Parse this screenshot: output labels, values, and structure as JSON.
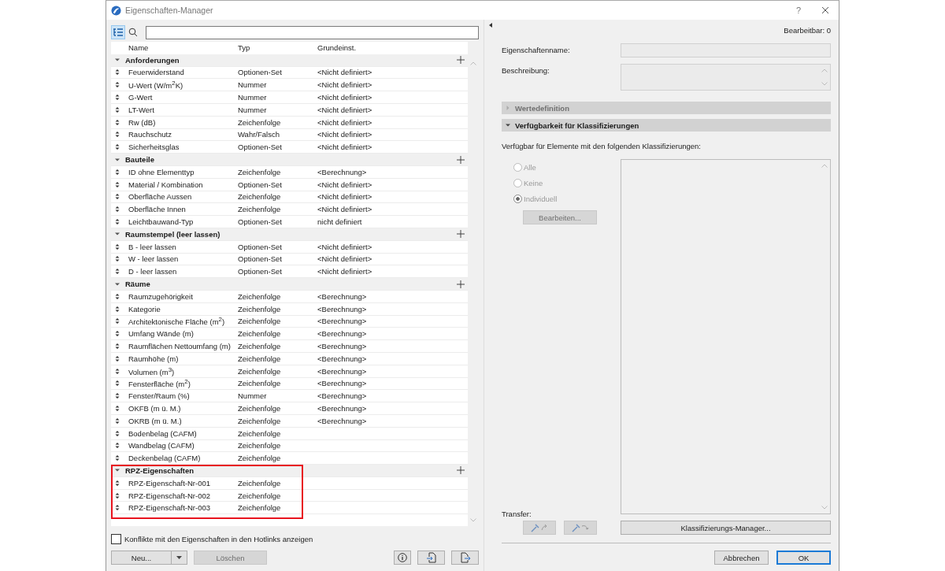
{
  "window": {
    "title": "Eigenschaften-Manager",
    "help": "?"
  },
  "toolbar": {
    "list_view_on": true
  },
  "table": {
    "columns": [
      "Name",
      "Typ",
      "Grundeinst."
    ],
    "groups": [
      {
        "name": "Anforderungen",
        "expanded": true,
        "highlighted": false,
        "items": [
          {
            "name": "Feuerwiderstand",
            "type": "Optionen-Set",
            "default": "<Nicht definiert>"
          },
          {
            "name": "U-Wert (W/m$^{2}$K)",
            "type": "Nummer",
            "default": "<Nicht definiert>"
          },
          {
            "name": "G-Wert",
            "type": "Nummer",
            "default": "<Nicht definiert>"
          },
          {
            "name": "LT-Wert",
            "type": "Nummer",
            "default": "<Nicht definiert>"
          },
          {
            "name": "Rw (dB)",
            "type": "Zeichenfolge",
            "default": "<Nicht definiert>"
          },
          {
            "name": "Rauchschutz",
            "type": "Wahr/Falsch",
            "default": "<Nicht definiert>"
          },
          {
            "name": "Sicherheitsglas",
            "type": "Optionen-Set",
            "default": "<Nicht definiert>"
          }
        ]
      },
      {
        "name": "Bauteile",
        "expanded": true,
        "highlighted": false,
        "items": [
          {
            "name": "ID ohne Elementtyp",
            "type": "Zeichenfolge",
            "default": "<Berechnung>"
          },
          {
            "name": "Material / Kombination",
            "type": "Optionen-Set",
            "default": "<Nicht definiert>"
          },
          {
            "name": "Oberfläche Aussen",
            "type": "Zeichenfolge",
            "default": "<Nicht definiert>"
          },
          {
            "name": "Oberfläche Innen",
            "type": "Zeichenfolge",
            "default": "<Nicht definiert>"
          },
          {
            "name": "Leichtbauwand-Typ",
            "type": "Optionen-Set",
            "default": "nicht definiert"
          }
        ]
      },
      {
        "name": "Raumstempel (leer lassen)",
        "expanded": true,
        "highlighted": false,
        "items": [
          {
            "name": "B - leer lassen",
            "type": "Optionen-Set",
            "default": "<Nicht definiert>"
          },
          {
            "name": "W - leer lassen",
            "type": "Optionen-Set",
            "default": "<Nicht definiert>"
          },
          {
            "name": "D - leer lassen",
            "type": "Optionen-Set",
            "default": "<Nicht definiert>"
          }
        ]
      },
      {
        "name": "Räume",
        "expanded": true,
        "highlighted": false,
        "items": [
          {
            "name": "Raumzugehörigkeit",
            "type": "Zeichenfolge",
            "default": "<Berechnung>"
          },
          {
            "name": "Kategorie",
            "type": "Zeichenfolge",
            "default": "<Berechnung>"
          },
          {
            "name": "Architektonische Fläche (m$^{2}$)",
            "type": "Zeichenfolge",
            "default": "<Berechnung>"
          },
          {
            "name": "Umfang Wände (m)",
            "type": "Zeichenfolge",
            "default": "<Berechnung>"
          },
          {
            "name": "Raumflächen Nettoumfang (m)",
            "type": "Zeichenfolge",
            "default": "<Berechnung>"
          },
          {
            "name": "Raumhöhe (m)",
            "type": "Zeichenfolge",
            "default": "<Berechnung>"
          },
          {
            "name": "Volumen (m$^{3}$)",
            "type": "Zeichenfolge",
            "default": "<Berechnung>"
          },
          {
            "name": "Fensterfläche (m$^{2}$)",
            "type": "Zeichenfolge",
            "default": "<Berechnung>"
          },
          {
            "name": "Fenster/Raum (%)",
            "type": "Nummer",
            "default": "<Berechnung>"
          },
          {
            "name": "OKFB (m ü. M.)",
            "type": "Zeichenfolge",
            "default": "<Berechnung>"
          },
          {
            "name": "OKRB (m ü. M.)",
            "type": "Zeichenfolge",
            "default": "<Berechnung>"
          },
          {
            "name": "Bodenbelag (CAFM)",
            "type": "Zeichenfolge"
          },
          {
            "name": "Wandbelag (CAFM)",
            "type": "Zeichenfolge"
          },
          {
            "name": "Deckenbelag (CAFM)",
            "type": "Zeichenfolge"
          }
        ]
      },
      {
        "name": "RPZ-Eigenschaften",
        "expanded": true,
        "highlighted": true,
        "items": [
          {
            "name": "RPZ-Eigenschaft-Nr-001",
            "type": "Zeichenfolge"
          },
          {
            "name": "RPZ-Eigenschaft-Nr-002",
            "type": "Zeichenfolge"
          },
          {
            "name": "RPZ-Eigenschaft-Nr-003",
            "type": "Zeichenfolge"
          }
        ]
      }
    ]
  },
  "hotlink_conflicts": {
    "label": "Konflikte mit den Eigenschaften in den Hotlinks anzeigen",
    "checked": false
  },
  "left_buttons": [
    {
      "label": "Neu...",
      "disabled": false,
      "dropdown": true
    },
    {
      "label": "Löschen",
      "disabled": true,
      "dropdown": false
    }
  ],
  "editable": "Bearbeitbar: 0",
  "fields": [
    {
      "label": "Eigenschaftenname:",
      "kind": "line"
    },
    {
      "label": "Beschreibung:",
      "kind": "area"
    }
  ],
  "sections": [
    {
      "title": "Wertedefinition",
      "expanded": false,
      "disabled": true
    },
    {
      "title": "Verfügbarkeit für Klassifizierungen",
      "expanded": true,
      "disabled": false
    }
  ],
  "availability": {
    "text": "Verfügbar für Elemente mit den folgenden Klassifizierungen:",
    "options": [
      {
        "label": "Alle",
        "selected": false,
        "disabled": true
      },
      {
        "label": "Keine",
        "selected": false,
        "disabled": true
      },
      {
        "label": "Individuell",
        "selected": true,
        "disabled": true
      }
    ],
    "edit_button": {
      "label": "Bearbeiten...",
      "disabled": true
    }
  },
  "transfer": {
    "label": "Transfer:",
    "disabled": true
  },
  "classification_manager": "Klassifizierungs-Manager...",
  "dialog_buttons": [
    {
      "label": "Abbrechen",
      "default": false
    },
    {
      "label": "OK",
      "default": true
    }
  ]
}
